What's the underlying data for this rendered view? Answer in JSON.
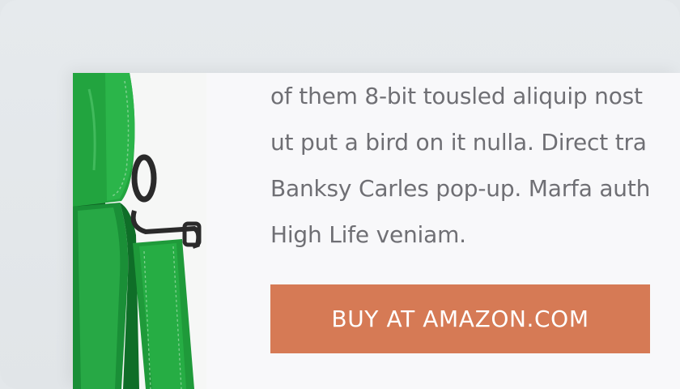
{
  "description": {
    "lines": [
      "of them 8-bit tousled aliquip nost",
      "ut put a bird on it nulla. Direct tra",
      "Banksy Carles pop-up. Marfa auth",
      "High Life veniam."
    ]
  },
  "buy_button": {
    "label": "BUY AT AMAZON.COM"
  },
  "product_image": {
    "icon": "green-leather-bag-image",
    "colors": {
      "leather": "#1f9a3a",
      "leather_dark": "#0f6a26",
      "hardware": "#2a2a2a"
    }
  },
  "colors": {
    "accent": "#d67a55",
    "text": "#6f6f74",
    "card_bg": "#f8f8fa",
    "page_bg": "#e3e7ea"
  }
}
